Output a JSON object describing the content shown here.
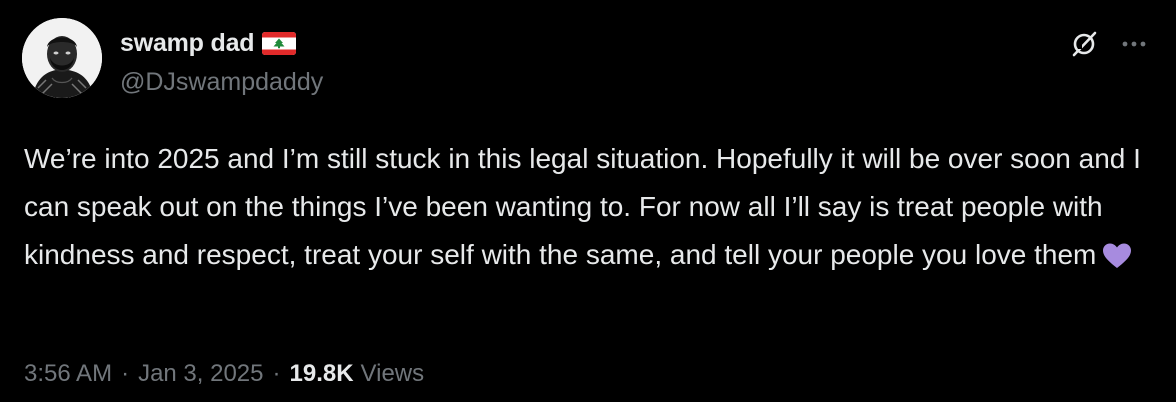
{
  "tweet": {
    "author": {
      "display_name": "swamp dad",
      "handle": "@DJswampdaddy",
      "flag_emoji": "lebanon-flag"
    },
    "text": "We’re into 2025 and I’m still stuck in this legal situation. Hopefully it will be over soon and I can speak out on the things I’ve been wanting to. For now all I’ll say is treat people with kindness and respect, treat your self with the same, and tell your people you love them",
    "emoji": "purple-heart",
    "time": "3:56 AM",
    "separator": "·",
    "date": "Jan 3, 2025",
    "views_count": "19.8K",
    "views_label": "Views"
  },
  "icons": {
    "grok": "grok-icon",
    "more": "more-icon"
  },
  "colors": {
    "background": "#000000",
    "primary_text": "#e7e9ea",
    "secondary_text": "#71767b",
    "heart": "#a78bdf",
    "flag_red": "#e12a2a",
    "flag_green": "#1f8a3a"
  }
}
